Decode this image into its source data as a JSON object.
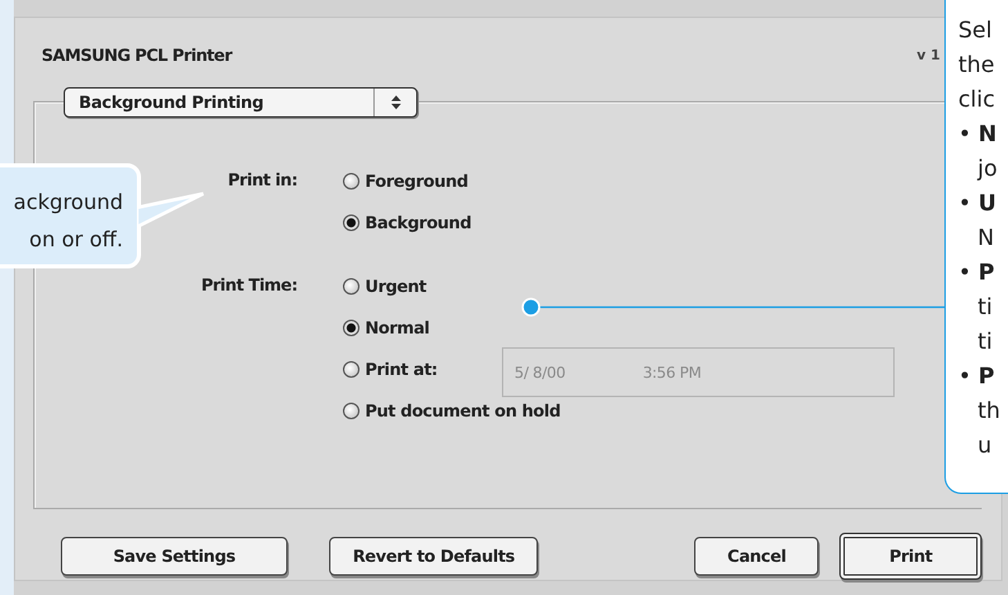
{
  "dialog": {
    "title": "SAMSUNG PCL Printer",
    "version": "v 1",
    "panel_menu": {
      "value": "Background Printing"
    },
    "groups": [
      {
        "label": "Print in:",
        "options": [
          {
            "label": "Foreground",
            "selected": false
          },
          {
            "label": "Background",
            "selected": true
          }
        ]
      },
      {
        "label": "Print Time:",
        "options": [
          {
            "label": "Urgent",
            "selected": false
          },
          {
            "label": "Normal",
            "selected": true
          },
          {
            "label": "Print at:",
            "selected": false,
            "date": "5/ 8/00",
            "time": "3:56 PM"
          },
          {
            "label": "Put document on hold",
            "selected": false
          }
        ]
      }
    ],
    "buttons": [
      {
        "label": "Save Settings",
        "default": false
      },
      {
        "label": "Revert to Defaults",
        "default": false
      },
      {
        "label": "Cancel",
        "default": false
      },
      {
        "label": "Print",
        "default": true
      }
    ]
  },
  "left_callout": {
    "lines": [
      "ackground",
      "on or off."
    ]
  },
  "right_callout": {
    "lines": [
      {
        "kind": "text",
        "text": "Sel"
      },
      {
        "kind": "text",
        "text": "the"
      },
      {
        "kind": "text",
        "text": "clic"
      },
      {
        "kind": "bullet",
        "text": "• **N**"
      },
      {
        "kind": "text",
        "text": "jo"
      },
      {
        "kind": "bullet",
        "text": "• **U**"
      },
      {
        "kind": "text",
        "text": "N"
      },
      {
        "kind": "bullet",
        "text": "• **P**"
      },
      {
        "kind": "text",
        "text": "ti"
      },
      {
        "kind": "text",
        "text": "ti"
      },
      {
        "kind": "bullet",
        "text": "• **P**"
      },
      {
        "kind": "text",
        "text": "th"
      },
      {
        "kind": "text",
        "text": "u"
      }
    ]
  }
}
